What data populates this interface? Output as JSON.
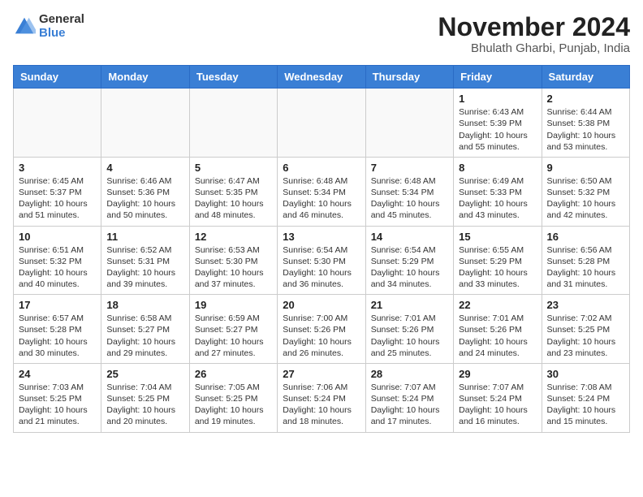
{
  "logo": {
    "general": "General",
    "blue": "Blue"
  },
  "header": {
    "month": "November 2024",
    "location": "Bhulath Gharbi, Punjab, India"
  },
  "days_of_week": [
    "Sunday",
    "Monday",
    "Tuesday",
    "Wednesday",
    "Thursday",
    "Friday",
    "Saturday"
  ],
  "weeks": [
    [
      {
        "day": "",
        "info": ""
      },
      {
        "day": "",
        "info": ""
      },
      {
        "day": "",
        "info": ""
      },
      {
        "day": "",
        "info": ""
      },
      {
        "day": "",
        "info": ""
      },
      {
        "day": "1",
        "info": "Sunrise: 6:43 AM\nSunset: 5:39 PM\nDaylight: 10 hours\nand 55 minutes."
      },
      {
        "day": "2",
        "info": "Sunrise: 6:44 AM\nSunset: 5:38 PM\nDaylight: 10 hours\nand 53 minutes."
      }
    ],
    [
      {
        "day": "3",
        "info": "Sunrise: 6:45 AM\nSunset: 5:37 PM\nDaylight: 10 hours\nand 51 minutes."
      },
      {
        "day": "4",
        "info": "Sunrise: 6:46 AM\nSunset: 5:36 PM\nDaylight: 10 hours\nand 50 minutes."
      },
      {
        "day": "5",
        "info": "Sunrise: 6:47 AM\nSunset: 5:35 PM\nDaylight: 10 hours\nand 48 minutes."
      },
      {
        "day": "6",
        "info": "Sunrise: 6:48 AM\nSunset: 5:34 PM\nDaylight: 10 hours\nand 46 minutes."
      },
      {
        "day": "7",
        "info": "Sunrise: 6:48 AM\nSunset: 5:34 PM\nDaylight: 10 hours\nand 45 minutes."
      },
      {
        "day": "8",
        "info": "Sunrise: 6:49 AM\nSunset: 5:33 PM\nDaylight: 10 hours\nand 43 minutes."
      },
      {
        "day": "9",
        "info": "Sunrise: 6:50 AM\nSunset: 5:32 PM\nDaylight: 10 hours\nand 42 minutes."
      }
    ],
    [
      {
        "day": "10",
        "info": "Sunrise: 6:51 AM\nSunset: 5:32 PM\nDaylight: 10 hours\nand 40 minutes."
      },
      {
        "day": "11",
        "info": "Sunrise: 6:52 AM\nSunset: 5:31 PM\nDaylight: 10 hours\nand 39 minutes."
      },
      {
        "day": "12",
        "info": "Sunrise: 6:53 AM\nSunset: 5:30 PM\nDaylight: 10 hours\nand 37 minutes."
      },
      {
        "day": "13",
        "info": "Sunrise: 6:54 AM\nSunset: 5:30 PM\nDaylight: 10 hours\nand 36 minutes."
      },
      {
        "day": "14",
        "info": "Sunrise: 6:54 AM\nSunset: 5:29 PM\nDaylight: 10 hours\nand 34 minutes."
      },
      {
        "day": "15",
        "info": "Sunrise: 6:55 AM\nSunset: 5:29 PM\nDaylight: 10 hours\nand 33 minutes."
      },
      {
        "day": "16",
        "info": "Sunrise: 6:56 AM\nSunset: 5:28 PM\nDaylight: 10 hours\nand 31 minutes."
      }
    ],
    [
      {
        "day": "17",
        "info": "Sunrise: 6:57 AM\nSunset: 5:28 PM\nDaylight: 10 hours\nand 30 minutes."
      },
      {
        "day": "18",
        "info": "Sunrise: 6:58 AM\nSunset: 5:27 PM\nDaylight: 10 hours\nand 29 minutes."
      },
      {
        "day": "19",
        "info": "Sunrise: 6:59 AM\nSunset: 5:27 PM\nDaylight: 10 hours\nand 27 minutes."
      },
      {
        "day": "20",
        "info": "Sunrise: 7:00 AM\nSunset: 5:26 PM\nDaylight: 10 hours\nand 26 minutes."
      },
      {
        "day": "21",
        "info": "Sunrise: 7:01 AM\nSunset: 5:26 PM\nDaylight: 10 hours\nand 25 minutes."
      },
      {
        "day": "22",
        "info": "Sunrise: 7:01 AM\nSunset: 5:26 PM\nDaylight: 10 hours\nand 24 minutes."
      },
      {
        "day": "23",
        "info": "Sunrise: 7:02 AM\nSunset: 5:25 PM\nDaylight: 10 hours\nand 23 minutes."
      }
    ],
    [
      {
        "day": "24",
        "info": "Sunrise: 7:03 AM\nSunset: 5:25 PM\nDaylight: 10 hours\nand 21 minutes."
      },
      {
        "day": "25",
        "info": "Sunrise: 7:04 AM\nSunset: 5:25 PM\nDaylight: 10 hours\nand 20 minutes."
      },
      {
        "day": "26",
        "info": "Sunrise: 7:05 AM\nSunset: 5:25 PM\nDaylight: 10 hours\nand 19 minutes."
      },
      {
        "day": "27",
        "info": "Sunrise: 7:06 AM\nSunset: 5:24 PM\nDaylight: 10 hours\nand 18 minutes."
      },
      {
        "day": "28",
        "info": "Sunrise: 7:07 AM\nSunset: 5:24 PM\nDaylight: 10 hours\nand 17 minutes."
      },
      {
        "day": "29",
        "info": "Sunrise: 7:07 AM\nSunset: 5:24 PM\nDaylight: 10 hours\nand 16 minutes."
      },
      {
        "day": "30",
        "info": "Sunrise: 7:08 AM\nSunset: 5:24 PM\nDaylight: 10 hours\nand 15 minutes."
      }
    ]
  ]
}
